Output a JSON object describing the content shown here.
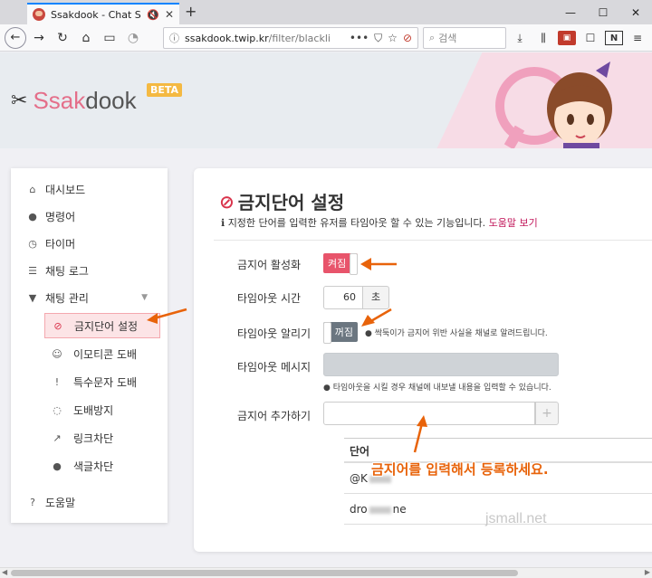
{
  "browser": {
    "tab_title": "Ssakdook - Chat Spam Set",
    "tab_mute": "🔇",
    "tab_close": "✕",
    "new_tab": "+",
    "win_min": "—",
    "win_max": "☐",
    "win_close": "✕",
    "url_host": "ssakdook.twip.kr",
    "url_path": "/filter/blackli",
    "url_more": "•••",
    "search_placeholder": "검색"
  },
  "hero": {
    "logo_prefix": "Ssak",
    "logo_suffix": "dook",
    "beta": "BETA"
  },
  "sidebar": {
    "items": [
      {
        "label": "대시보드",
        "icon": "home-icon"
      },
      {
        "label": "명령어",
        "icon": "exclamation-circle-icon"
      },
      {
        "label": "타이머",
        "icon": "clock-icon"
      },
      {
        "label": "채팅 로그",
        "icon": "database-icon"
      },
      {
        "label": "채팅 관리",
        "icon": "filter-icon"
      }
    ],
    "sub_items": [
      {
        "label": "금지단어 설정",
        "icon": "ban-icon"
      },
      {
        "label": "이모티콘 도배",
        "icon": "smile-icon"
      },
      {
        "label": "특수문자 도배",
        "icon": "exclamation-icon"
      },
      {
        "label": "도배방지",
        "icon": "chat-icon"
      },
      {
        "label": "링크차단",
        "icon": "external-link-icon"
      },
      {
        "label": "색글차단",
        "icon": "droplet-icon"
      }
    ],
    "help": "도움말"
  },
  "content": {
    "title": "금지단어 설정",
    "desc": "지정한 단어를 입력한 유저를 타임아웃 할 수 있는 기능입니다.",
    "help_link": "도움말 보기",
    "enable_label": "금지어 활성화",
    "enable_state": "켜짐",
    "timeout_label": "타임아웃 시간",
    "timeout_value": "60",
    "timeout_unit": "초",
    "notify_label": "타임아웃 알리기",
    "notify_state": "꺼짐",
    "notify_hint": "싹둑이가 금지어 위반 사실을 채널로 알려드립니다.",
    "message_label": "타임아웃 메시지",
    "message_hint": "타임아웃을 시킬 경우 채널에 내보낼 내용을 입력할 수 있습니다.",
    "add_label": "금지어 추가하기",
    "add_button": "+",
    "table_header": "단어",
    "rows": [
      {
        "start": "@K",
        "end": ""
      },
      {
        "start": "dro",
        "end": "ne"
      }
    ]
  },
  "annotation": "금지어를 입력해서 등록하세요.",
  "watermark": "jsmall.net",
  "colors": {
    "accent": "#e8546b",
    "brand": "#e46f8a",
    "arrow": "#e8630a"
  }
}
